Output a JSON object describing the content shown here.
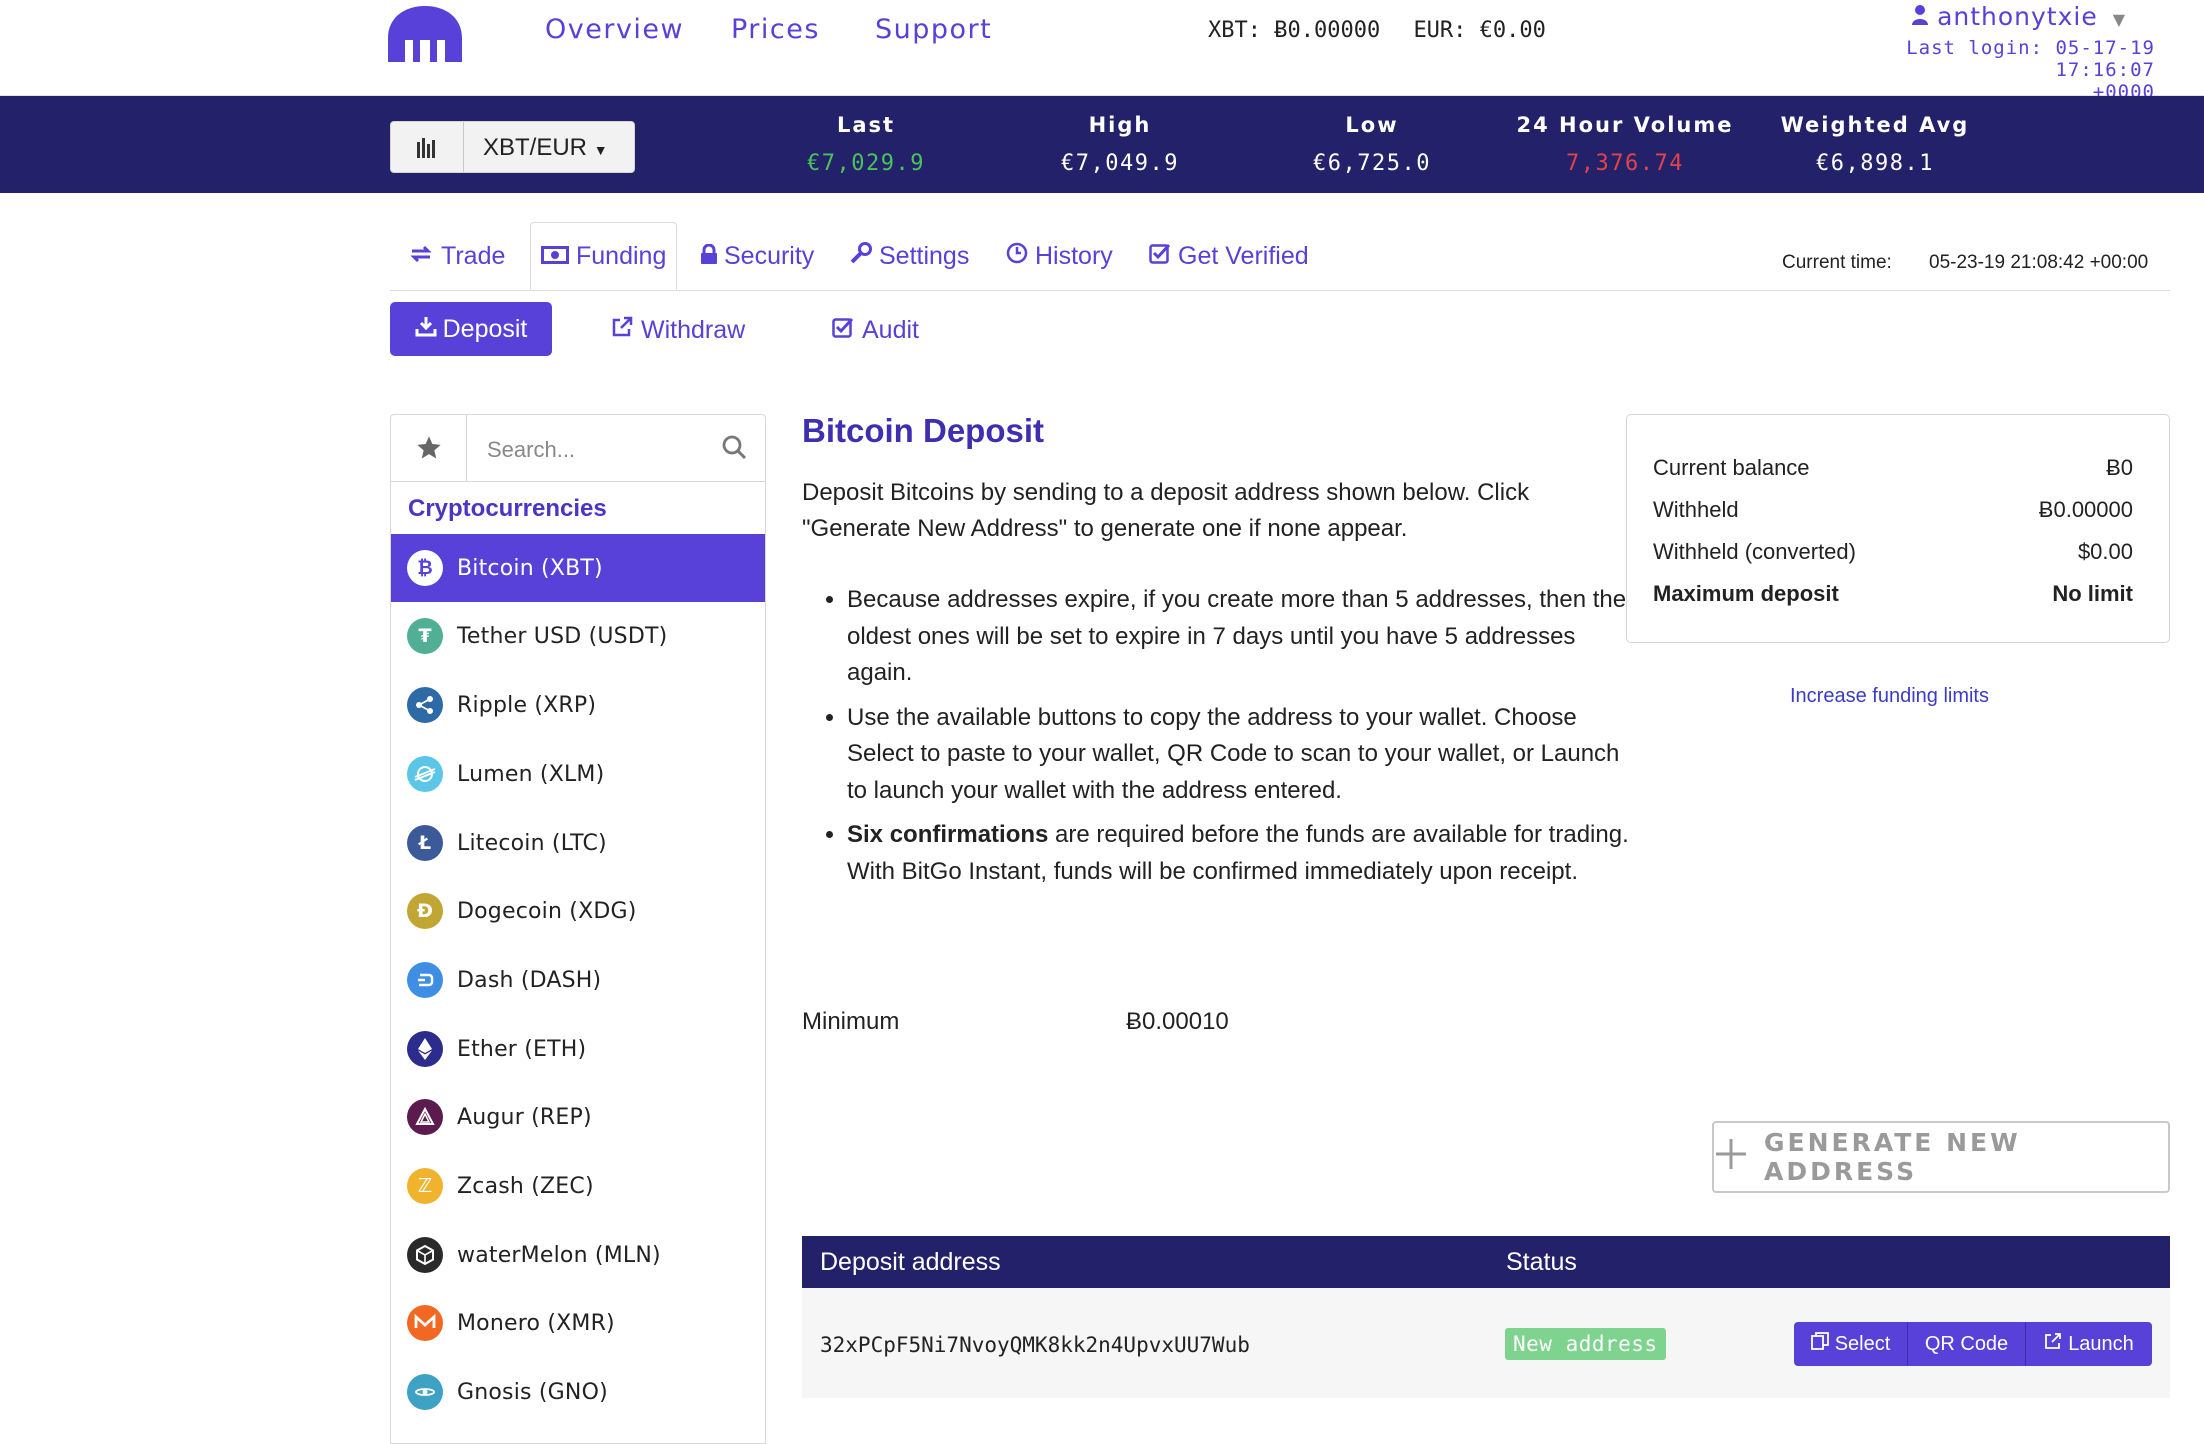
{
  "nav": {
    "links": [
      "Overview",
      "Prices",
      "Support"
    ],
    "balance_xbt": "XBT: Ƀ0.00000",
    "balance_eur": "EUR: €0.00",
    "username": "anthonytxie",
    "last_login_line1": "Last login: 05-17-19 17:16:07",
    "last_login_line2": "+0000"
  },
  "ticker": {
    "pair": "XBT/EUR",
    "stats": [
      {
        "label": "Last",
        "value": "€7,029.9",
        "color": "#4cc25a"
      },
      {
        "label": "High",
        "value": "€7,049.9",
        "color": "#ffffff"
      },
      {
        "label": "Low",
        "value": "€6,725.0",
        "color": "#ffffff"
      },
      {
        "label": "24 Hour Volume",
        "value": "7,376.74",
        "color": "#e0434a"
      },
      {
        "label": "Weighted Avg",
        "value": "€6,898.1",
        "color": "#ffffff"
      }
    ]
  },
  "tabs": {
    "items": [
      "Trade",
      "Funding",
      "Security",
      "Settings",
      "History",
      "Get Verified"
    ],
    "active": "Funding",
    "current_time_label": "Current time:",
    "current_time_value": "05-23-19 21:08:42 +00:00"
  },
  "subtabs": {
    "deposit": "Deposit",
    "withdraw": "Withdraw",
    "audit": "Audit"
  },
  "sidebar": {
    "search_placeholder": "Search...",
    "category_title": "Cryptocurrencies",
    "coins": [
      {
        "label": "Bitcoin (XBT)",
        "icon": "bitcoin-icon",
        "color": "#ffffff"
      },
      {
        "label": "Tether USD (USDT)",
        "icon": "tether-icon",
        "color": "#50af95"
      },
      {
        "label": "Ripple (XRP)",
        "icon": "ripple-icon",
        "color": "#2e6ba6"
      },
      {
        "label": "Lumen (XLM)",
        "icon": "lumen-icon",
        "color": "#5cc6e8"
      },
      {
        "label": "Litecoin (LTC)",
        "icon": "litecoin-icon",
        "color": "#3c5a99"
      },
      {
        "label": "Dogecoin (XDG)",
        "icon": "dogecoin-icon",
        "color": "#c2a633"
      },
      {
        "label": "Dash (DASH)",
        "icon": "dash-icon",
        "color": "#3e8fe3"
      },
      {
        "label": "Ether (ETH)",
        "icon": "ether-icon",
        "color": "#2c2c8c"
      },
      {
        "label": "Augur (REP)",
        "icon": "augur-icon",
        "color": "#5b1b4f"
      },
      {
        "label": "Zcash (ZEC)",
        "icon": "zcash-icon",
        "color": "#f1b32e"
      },
      {
        "label": "waterMelon (MLN)",
        "icon": "watermelon-icon",
        "color": "#2a2a2a"
      },
      {
        "label": "Monero (XMR)",
        "icon": "monero-icon",
        "color": "#f26822"
      },
      {
        "label": "Gnosis (GNO)",
        "icon": "gnosis-icon",
        "color": "#3ea2c5"
      }
    ]
  },
  "main": {
    "title": "Bitcoin Deposit",
    "intro": "Deposit Bitcoins by sending to a deposit address shown below. Click \"Generate New Address\" to generate one if none appear.",
    "bullet1": "Because addresses expire, if you create more than 5 addresses, then the oldest ones will be set to expire in 7 days until you have 5 addresses again.",
    "bullet2": "Use the available buttons to copy the address to your wallet. Choose Select to paste to your wallet, QR Code to scan to your wallet, or Launch to launch your wallet with the address entered.",
    "bullet3_bold": "Six confirmations",
    "bullet3_rest": " are required before the funds are available for trading. With BitGo Instant, funds will be confirmed immediately upon receipt.",
    "minimum_label": "Minimum",
    "minimum_value": "Ƀ0.00010",
    "generate_label": "GENERATE NEW ADDRESS"
  },
  "balance_card": {
    "rows": [
      {
        "label": "Current balance",
        "value": "Ƀ0"
      },
      {
        "label": "Withheld",
        "value": "Ƀ0.00000"
      },
      {
        "label": "Withheld (converted)",
        "value": "$0.00"
      },
      {
        "label": "Maximum deposit",
        "value": "No limit"
      }
    ],
    "increase_link": "Increase funding limits"
  },
  "address_table": {
    "col_address": "Deposit address",
    "col_status": "Status",
    "address": "32xPCpF5Ni7NvoyQMK8kk2n4UpvxUU7Wub",
    "status": "New address",
    "buttons": [
      "Select",
      "QR Code",
      "Launch"
    ]
  },
  "colors": {
    "accent": "#5741d9",
    "ticker_bg": "#23216a",
    "status_green": "#7ed48f"
  }
}
